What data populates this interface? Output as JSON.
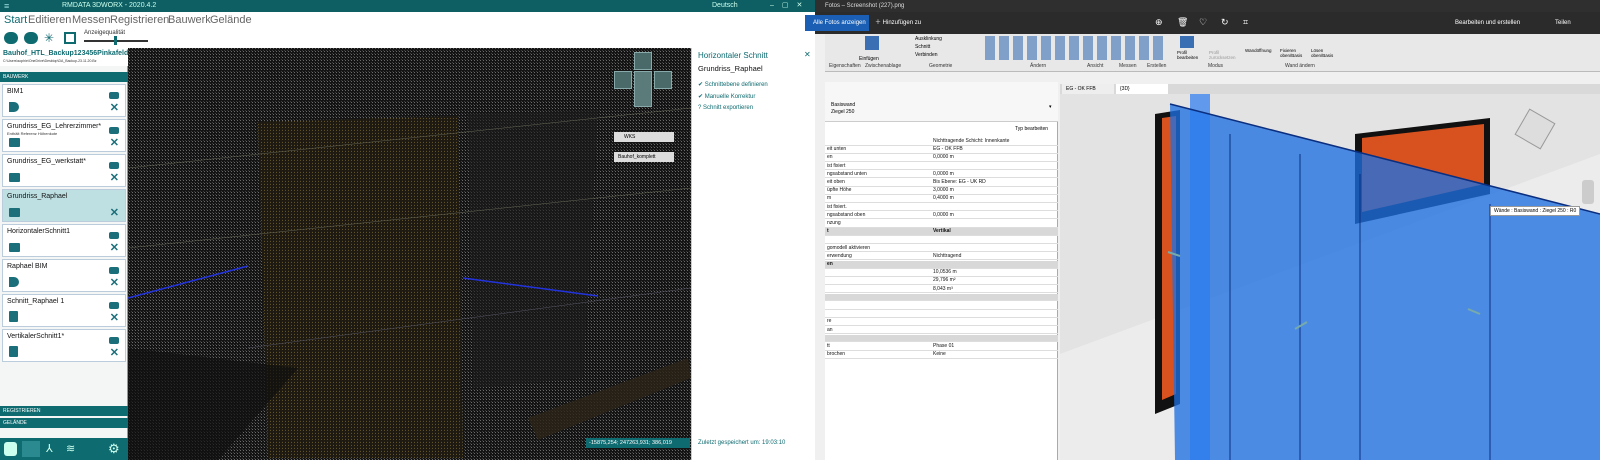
{
  "left_app": {
    "title": "RMDATA 3DWORX - 2020.4.2",
    "search_label": "Deutsch",
    "menu": [
      "Start",
      "Editieren",
      "Messen",
      "Registrieren",
      "Bauwerk",
      "Gelände"
    ],
    "toolbar": {
      "quality_label": "Anzeigequalität"
    },
    "project": {
      "name": "Bauhof_HTL_Backup123456Pinkafeld",
      "path": "C:\\Users\\sophie\\OneDrive\\Desktop\\DA_Backup-23.11.20.Bz"
    },
    "category_label": "BAUWERK",
    "items": [
      {
        "name": "BIM1",
        "sub": ""
      },
      {
        "name": "Grundriss_EG_Lehrerzimmer*",
        "sub": "Enthält Referenz Höhenkote"
      },
      {
        "name": "Grundriss_EG_werkstatt*",
        "sub": ""
      },
      {
        "name": "Grundriss_Raphael",
        "sub": ""
      },
      {
        "name": "HorizontalerSchnitt1",
        "sub": ""
      },
      {
        "name": "Raphael BIM",
        "sub": ""
      },
      {
        "name": "Schnitt_Raphael 1",
        "sub": ""
      },
      {
        "name": "VertikalerSchnitt1*",
        "sub": ""
      }
    ],
    "bottom_labels": [
      "REGISTRIEREN",
      "GELÄNDE"
    ],
    "viewport": {
      "ws_label": "WKS",
      "layer_label": "Bauhof_komplett",
      "coords": "-15875,254; 247263,931; 386,019"
    },
    "panel": {
      "title": "Horizontaler Schnitt",
      "subtitle": "Grundriss_Raphael",
      "steps": [
        "Schnittebene definieren",
        "Manuelle Korrektur",
        "Schnitt exportieren"
      ],
      "saved": "Zuletzt gespeichert um: 19:03:10"
    }
  },
  "right_app": {
    "title": "Fotos – Screenshot (227).png",
    "all_photos": "Alle Fotos anzeigen",
    "add_to": "Hinzufügen zu",
    "edit_create": "Bearbeiten und erstellen",
    "share": "Teilen",
    "ribbon_groups": [
      "Eigenschaften",
      "Zwischenablage",
      "Geometrie",
      "Ändern",
      "Ansicht",
      "Messen",
      "Erstellen",
      "Modus",
      "Wand ändern"
    ],
    "ribbon_buttons": [
      "Ausklinkung",
      "Schnitt",
      "Verbinden",
      "Einfügen",
      "Profil bearbeiten",
      "Profil zurücksetzen",
      "Wandöffnung",
      "Fixieren oben/Basis",
      "Lösen oben/Basis"
    ],
    "type_label": "Basiswand",
    "type_sub": "Ziegel 250",
    "type_edit": "Typ bearbeiten",
    "properties": [
      {
        "k": "",
        "v": "Nichttragende Schicht: Innenkante",
        "hdr": false
      },
      {
        "k": "eit unten",
        "v": "EG - OK FFB",
        "hdr": false
      },
      {
        "k": "en",
        "v": "0,0000 m",
        "hdr": false
      },
      {
        "k": "ist fixiert",
        "v": "",
        "hdr": false
      },
      {
        "k": "ngsabstand unten",
        "v": "0,0000 m",
        "hdr": false
      },
      {
        "k": "eit oben",
        "v": "Bis Ebene: EG - UK RD",
        "hdr": false
      },
      {
        "k": "üpfte Höhe",
        "v": "3,0000 m",
        "hdr": false
      },
      {
        "k": "m",
        "v": "0,4000 m",
        "hdr": false
      },
      {
        "k": "ist fixiert.",
        "v": "",
        "hdr": false
      },
      {
        "k": "ngsabstand oben",
        "v": "0,0000 m",
        "hdr": false
      },
      {
        "k": "nzung",
        "v": "",
        "hdr": false
      },
      {
        "k": "t",
        "v": "Vertikal",
        "hdr": true
      },
      {
        "k": "",
        "v": "",
        "hdr": false
      },
      {
        "k": "gomodell aktivieren",
        "v": "",
        "hdr": false
      },
      {
        "k": "erwendung",
        "v": "Nichttragend",
        "hdr": false
      },
      {
        "k": "en",
        "v": "",
        "hdr": true
      },
      {
        "k": "",
        "v": "10,0536 m",
        "hdr": false
      },
      {
        "k": "",
        "v": "29,796 m²",
        "hdr": false
      },
      {
        "k": "",
        "v": "8,043 m³",
        "hdr": false
      },
      {
        "k": "",
        "v": "",
        "hdr": true
      },
      {
        "k": "",
        "v": "",
        "hdr": false
      },
      {
        "k": "",
        "v": "",
        "hdr": false
      },
      {
        "k": "re",
        "v": "",
        "hdr": false
      },
      {
        "k": "an",
        "v": "",
        "hdr": false
      },
      {
        "k": "",
        "v": "",
        "hdr": true
      },
      {
        "k": "tt",
        "v": "Phase 01",
        "hdr": false
      },
      {
        "k": "brochen",
        "v": "Keine",
        "hdr": false
      }
    ],
    "view_tabs": [
      "EG - OK FFB",
      "{3D}"
    ],
    "tooltip": "Wände : Basiswand : Ziegel 250 : R0"
  }
}
